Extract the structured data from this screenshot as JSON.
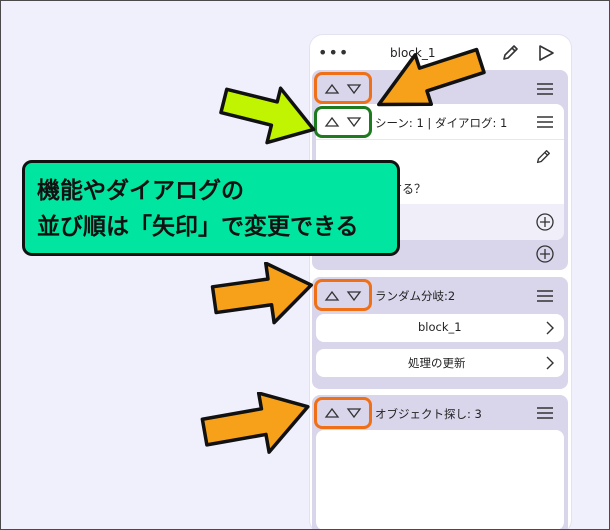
{
  "topbar": {
    "dots": "•••",
    "title": "block_1",
    "edit_icon": "pencil-icon",
    "run_icon": "play-icon"
  },
  "scene_card": {
    "row_label": "シーン: 1 | ダイアログ: 1",
    "dialog_text_fragment": "する？"
  },
  "branch_card": {
    "title": "ランダム分岐:2",
    "options": [
      "block_1",
      "処理の更新"
    ]
  },
  "search_card": {
    "title": "オブジェクト探し: 3"
  },
  "callout": {
    "line1": "機能やダイアログの",
    "line2": "並び順は「矢印」で変更できる"
  },
  "colors": {
    "background": "#f0effc",
    "card": "#d9d5eb",
    "highlight_orange": "#f07018",
    "highlight_green": "#1e7a1e",
    "callout_bg": "#00e6a0",
    "arrow_orange": "#f7a11a",
    "arrow_lime": "#c0f400"
  }
}
